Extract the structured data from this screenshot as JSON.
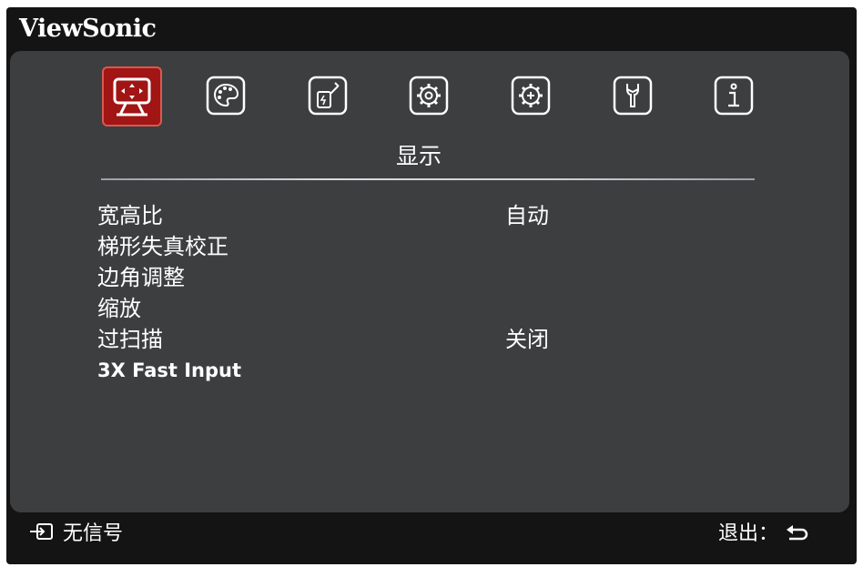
{
  "brand": "ViewSonic",
  "tabs": [
    {
      "icon": "display-icon",
      "active": true
    },
    {
      "icon": "palette-icon",
      "active": false
    },
    {
      "icon": "power-icon",
      "active": false
    },
    {
      "icon": "gear-icon",
      "active": false
    },
    {
      "icon": "advanced-gear-icon",
      "active": false
    },
    {
      "icon": "wrench-icon",
      "active": false
    },
    {
      "icon": "info-icon",
      "active": false
    }
  ],
  "active_tab_title": "显示",
  "menu": [
    {
      "label": "宽高比",
      "value": "自动"
    },
    {
      "label": "梯形失真校正",
      "value": ""
    },
    {
      "label": "边角调整",
      "value": ""
    },
    {
      "label": "缩放",
      "value": ""
    },
    {
      "label": "过扫描",
      "value": "关闭"
    },
    {
      "label": "3X Fast Input",
      "value": ""
    }
  ],
  "footer": {
    "input_status": "无信号",
    "exit_label": "退出："
  },
  "colors": {
    "background": "#141414",
    "panel": "#3d3e40",
    "active_tab": "#a11515",
    "text": "#ffffff"
  }
}
